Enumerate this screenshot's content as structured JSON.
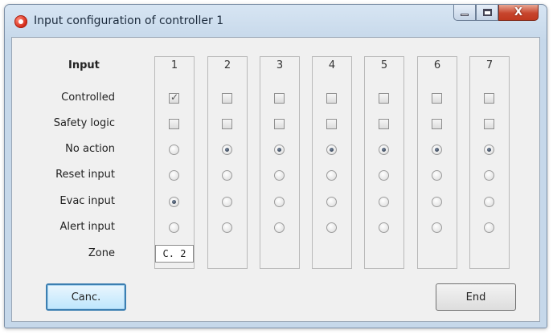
{
  "window": {
    "title": "Input configuration of controller 1",
    "controls": {
      "close_glyph": "X"
    },
    "icon": "app-logo-icon"
  },
  "table": {
    "header_label": "Input",
    "columns": [
      "1",
      "2",
      "3",
      "4",
      "5",
      "6",
      "7"
    ],
    "row_labels": {
      "controlled": "Controlled",
      "safety_logic": "Safety logic",
      "no_action": "No action",
      "reset_input": "Reset input",
      "evac_input": "Evac input",
      "alert_input": "Alert input",
      "zone": "Zone"
    },
    "controlled": [
      true,
      false,
      false,
      false,
      false,
      false,
      false
    ],
    "safety_logic": [
      false,
      false,
      false,
      false,
      false,
      false,
      false
    ],
    "selected_action": [
      "evac_input",
      "no_action",
      "no_action",
      "no_action",
      "no_action",
      "no_action",
      "no_action"
    ],
    "zone": [
      "C. 2",
      "",
      "",
      "",
      "",
      "",
      ""
    ]
  },
  "buttons": {
    "cancel": "Canc.",
    "end": "End"
  },
  "colors": {
    "accent": "#3c7fb1",
    "title_bar": "#c6d8ea",
    "close_button": "#c7452d"
  }
}
